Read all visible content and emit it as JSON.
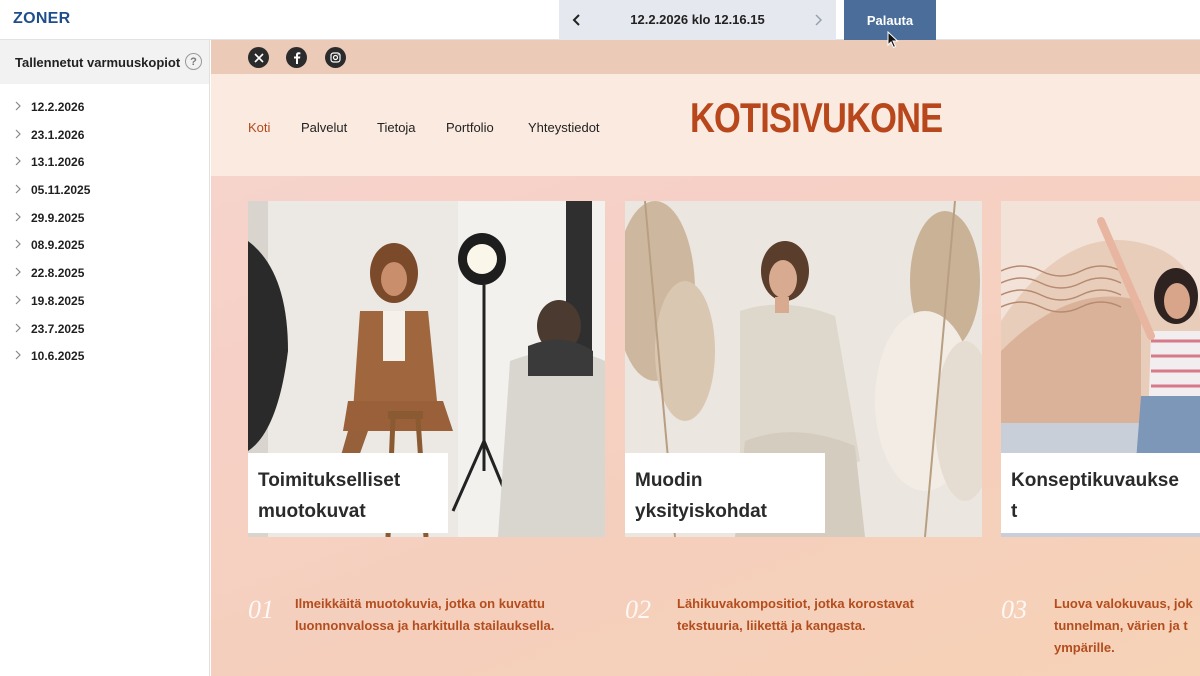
{
  "app": {
    "logo": "ZONER"
  },
  "toolbar": {
    "date_label": "12.2.2026 klo 12.16.15",
    "restore_label": "Palauta"
  },
  "sidebar": {
    "title": "Tallennetut varmuuskopiot",
    "help": "?",
    "items": [
      {
        "label": "12.2.2026"
      },
      {
        "label": "23.1.2026"
      },
      {
        "label": "13.1.2026"
      },
      {
        "label": "05.11.2025"
      },
      {
        "label": "29.9.2025"
      },
      {
        "label": "08.9.2025"
      },
      {
        "label": "22.8.2025"
      },
      {
        "label": "19.8.2025"
      },
      {
        "label": "23.7.2025"
      },
      {
        "label": "10.6.2025"
      }
    ]
  },
  "site": {
    "social": [
      "x-icon",
      "facebook-icon",
      "instagram-icon"
    ],
    "menu": [
      "Koti",
      "Palvelut",
      "Tietoja",
      "Portfolio",
      "Yhteystiedot"
    ],
    "brand": "KOTISIVUKONE",
    "cards": [
      {
        "line1": "Toimitukselliset",
        "line2": "muotokuvat"
      },
      {
        "line1": "Muodin",
        "line2": "yksityiskohdat"
      },
      {
        "line1": "Konseptikuvaukse",
        "line2": "t"
      }
    ],
    "features": [
      {
        "num": "01",
        "line1": "Ilmeikkäitä muotokuvia, jotka on kuvattu",
        "line2": "luonnonvalossa ja harkitulla stailauksella."
      },
      {
        "num": "02",
        "line1": "Lähikuvakompositiot, jotka korostavat",
        "line2": "tekstuuria, liikettä ja kangasta."
      },
      {
        "num": "03",
        "line1": "Luova valokuvaus, jok",
        "line2": "tunnelman, värien ja t",
        "line3": "ympärille."
      }
    ]
  },
  "colors": {
    "brand": "#b8481b",
    "accent": "#4a6e99",
    "logo": "#1f4e8c"
  }
}
